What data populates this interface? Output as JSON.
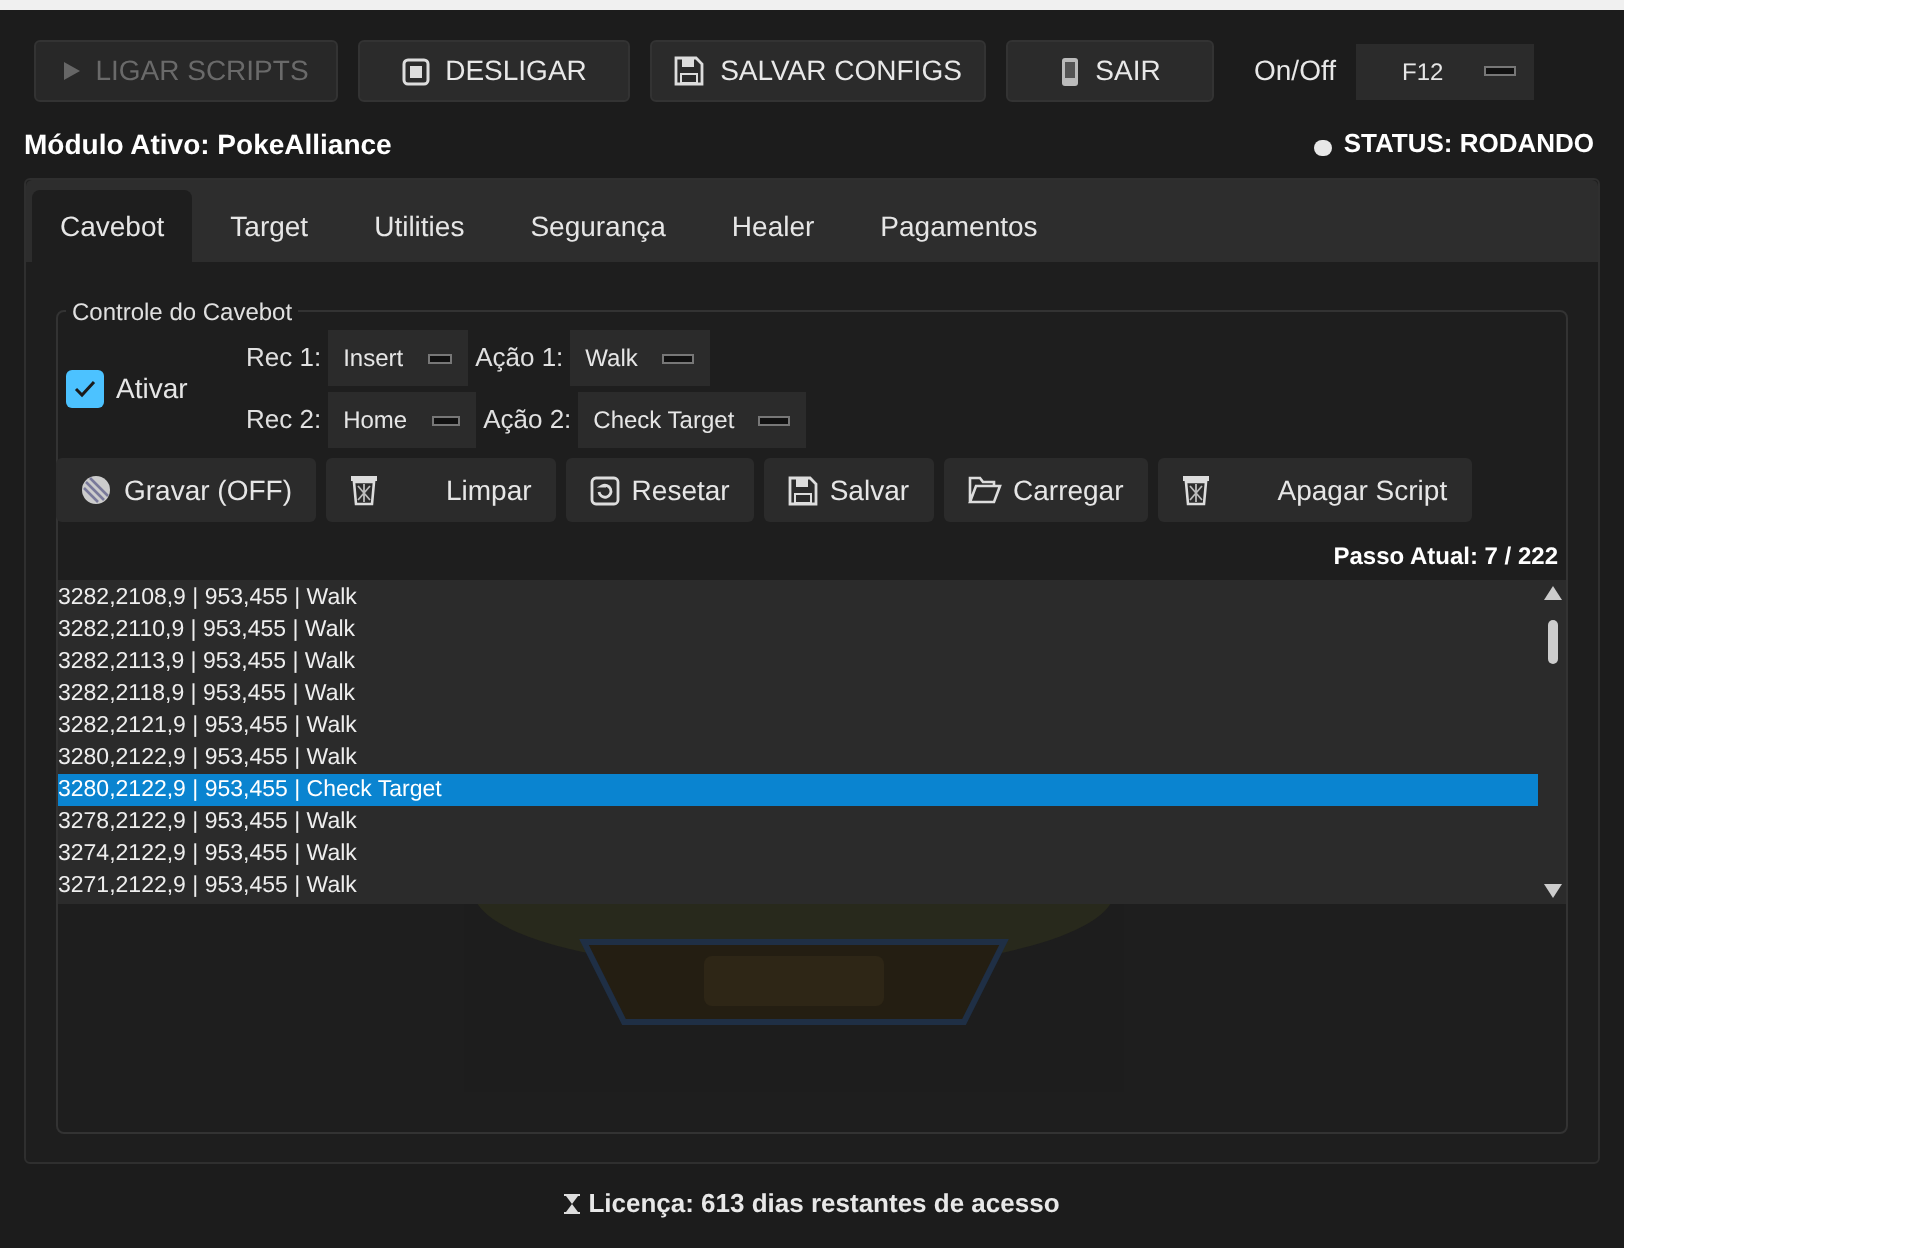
{
  "toolbar": {
    "buttons": [
      {
        "label": "LIGAR SCRIPTS",
        "kind": "play",
        "disabled": true
      },
      {
        "label": "DESLIGAR",
        "kind": "stop",
        "disabled": false
      },
      {
        "label": "SALVAR CONFIGS",
        "kind": "save",
        "disabled": false
      },
      {
        "label": "SAIR",
        "kind": "exit",
        "disabled": false
      }
    ],
    "hotkey": {
      "label": "On/Off",
      "key": "F12"
    }
  },
  "module": {
    "title": "Módulo Ativo: PokeAlliance",
    "status": "STATUS: RODANDO"
  },
  "tabs": [
    {
      "label": "Cavebot",
      "selected": true
    },
    {
      "label": "Target",
      "selected": false
    },
    {
      "label": "Utilities",
      "selected": false
    },
    {
      "label": "Segurança",
      "selected": false
    },
    {
      "label": "Healer",
      "selected": false
    },
    {
      "label": "Pagamentos",
      "selected": false
    }
  ],
  "group": {
    "title": "Controle do Cavebot",
    "enable": {
      "label": "Ativar",
      "checked": true
    },
    "hotkey_rows": [
      [
        {
          "label": "Rec 1:",
          "value": "Insert"
        },
        {
          "label": "Ação 1:",
          "value": "Walk"
        }
      ],
      [
        {
          "label": "Rec 2:",
          "value": "Home"
        },
        {
          "label": "Ação 2:",
          "value": "Check Target"
        }
      ]
    ]
  },
  "actions": [
    {
      "label": "Gravar (OFF)",
      "kind": "record"
    },
    {
      "label": "Limpar",
      "kind": "trash"
    },
    {
      "label": "Resetar",
      "kind": "reset"
    },
    {
      "label": "Salvar",
      "kind": "save"
    },
    {
      "label": "Carregar",
      "kind": "folder"
    },
    {
      "label": "Apagar Script",
      "kind": "trash"
    }
  ],
  "step": "Passo Atual: 7 / 222",
  "waypoints": [
    {
      "text": "3282,2108,9 | 953,455 | Walk",
      "selected": false
    },
    {
      "text": "3282,2110,9 | 953,455 | Walk",
      "selected": false
    },
    {
      "text": "3282,2113,9 | 953,455 | Walk",
      "selected": false
    },
    {
      "text": "3282,2118,9 | 953,455 | Walk",
      "selected": false
    },
    {
      "text": "3282,2121,9 | 953,455 | Walk",
      "selected": false
    },
    {
      "text": "3280,2122,9 | 953,455 | Walk",
      "selected": false
    },
    {
      "text": "3280,2122,9 | 953,455 | Check Target",
      "selected": true
    },
    {
      "text": "3278,2122,9 | 953,455 | Walk",
      "selected": false
    },
    {
      "text": "3274,2122,9 | 953,455 | Walk",
      "selected": false
    },
    {
      "text": "3271,2122,9 | 953,455 | Walk",
      "selected": false
    }
  ],
  "footer": "Licença: 613 dias restantes de acesso"
}
